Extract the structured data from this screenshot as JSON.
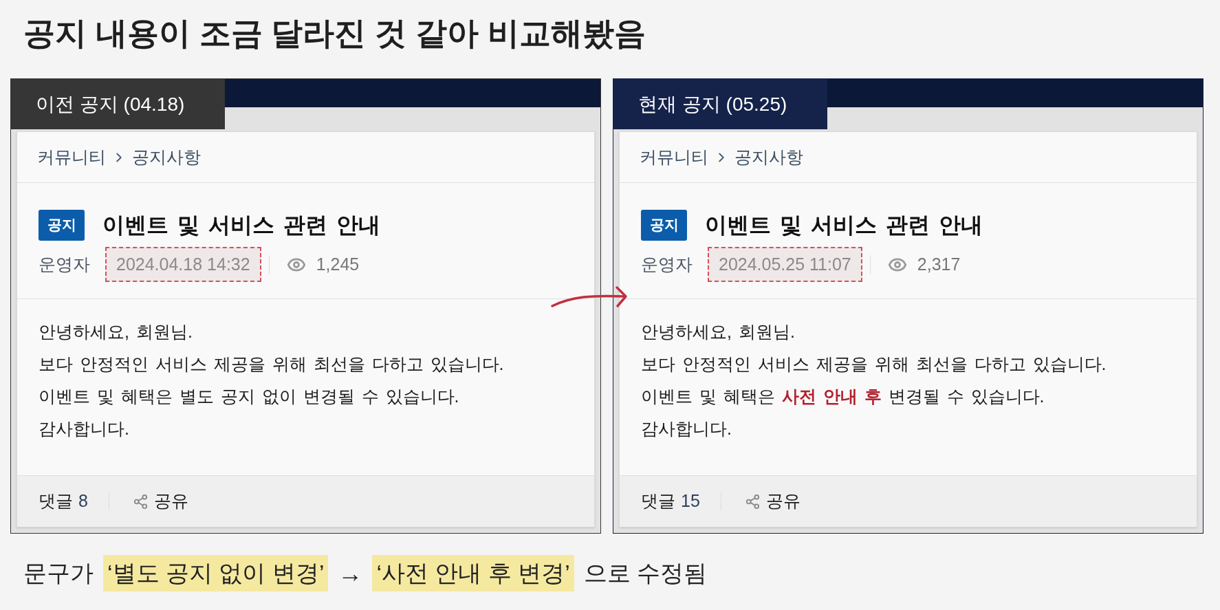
{
  "heading": "공지 내용이 조금 달라진 것 같아 비교해봤음",
  "panels": [
    {
      "label": "이전 공지 (04.18)",
      "color": "#363636",
      "breadcrumb": [
        "커뮤니티",
        "공지사항"
      ],
      "tag": "공지",
      "title": "이벤트 및 서비스 관련 안내",
      "author": "운영자",
      "date": {
        "text": "2024.04.18 14:32",
        "highlighted": true
      },
      "views": "1,245",
      "body": [
        "안녕하세요, 회원님.",
        "보다 안정적인 서비스 제공을 위해 최선을 다하고 있습니다.",
        "이벤트 및 혜택은 별도 공지 없이 변경될 수 있습니다.",
        "감사합니다."
      ],
      "comments_label": "댓글",
      "comments_count": "8",
      "share": "공유"
    },
    {
      "label": "현재 공지 (05.25)",
      "color": "#15234b",
      "breadcrumb": [
        "커뮤니티",
        "공지사항"
      ],
      "tag": "공지",
      "title": "이벤트 및 서비스 관련 안내",
      "author": "운영자",
      "date": {
        "text": "2024.05.25 11:07",
        "highlighted": true
      },
      "views": "2,317",
      "body": [
        "안녕하세요, 회원님.",
        "보다 안정적인 서비스 제공을 위해 최선을 다하고 있습니다.",
        "이벤트 및 혜택은 **사전 안내 후** 변경될 수 있습니다.",
        "감사합니다."
      ],
      "comments_label": "댓글",
      "comments_count": "15",
      "share": "공유"
    }
  ],
  "caption": [
    {
      "kind": "text",
      "text": "문구가",
      "highlighted": false
    },
    {
      "kind": "text",
      "text": "‘별도 공지 없이 변경’",
      "highlighted": true
    },
    {
      "kind": "arrow",
      "text": "→",
      "highlighted": false
    },
    {
      "kind": "text",
      "text": "‘사전 안내 후 변경’",
      "highlighted": true
    },
    {
      "kind": "text",
      "text": "으로 수정됨",
      "highlighted": false
    }
  ]
}
